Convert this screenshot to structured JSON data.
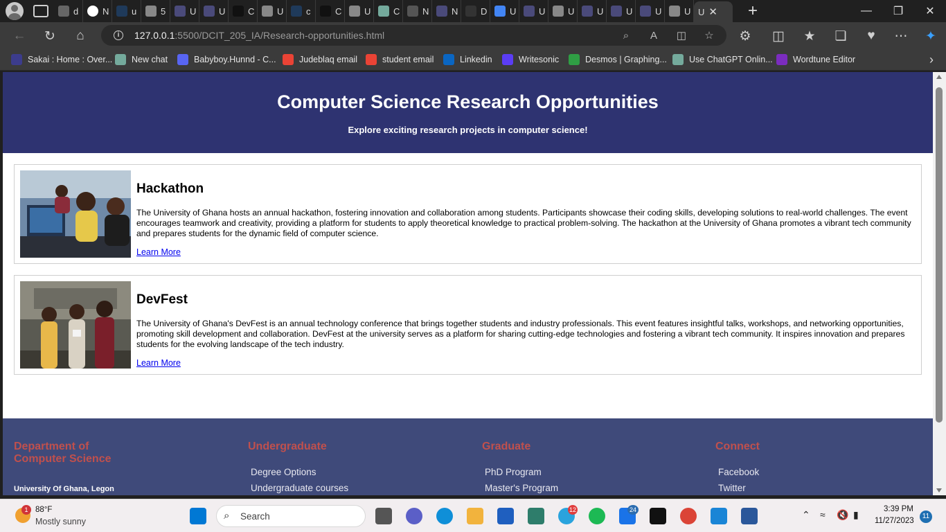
{
  "browser": {
    "active_tab_label": "U",
    "tabs": [
      "d",
      "N",
      "u",
      "5",
      "U",
      "U",
      "C",
      "U",
      "c",
      "C",
      "U",
      "C",
      "N",
      "N",
      "D",
      "U",
      "U",
      "U",
      "U",
      "U",
      "U",
      "U"
    ],
    "url_host": "127.0.0.1",
    "url_rest": ":5500/DCIT_205_IA/Research-opportunities.html"
  },
  "favorites": [
    {
      "label": "Sakai : Home : Over...",
      "color": "#3c3c8c"
    },
    {
      "label": "New chat",
      "color": "#74aa9c"
    },
    {
      "label": "Babyboy.Hunnd - C...",
      "color": "#5865f2"
    },
    {
      "label": "Judeblaq email",
      "color": "#ea4335"
    },
    {
      "label": "student email",
      "color": "#ea4335"
    },
    {
      "label": "Linkedin",
      "color": "#0a66c2"
    },
    {
      "label": "Writesonic",
      "color": "#5b3df5"
    },
    {
      "label": "Desmos | Graphing...",
      "color": "#2f9e44"
    },
    {
      "label": "Use ChatGPT Onlin...",
      "color": "#74aa9c"
    },
    {
      "label": "Wordtune Editor",
      "color": "#7b2cbf"
    }
  ],
  "page": {
    "title": "Computer Science Research Opportunities",
    "subtitle": "Explore exciting research projects in computer science!",
    "cards": [
      {
        "title": "Hackathon",
        "description": "The University of Ghana hosts an annual hackathon, fostering innovation and collaboration among students. Participants showcase their coding skills, developing solutions to real-world challenges. The event encourages teamwork and creativity, providing a platform for students to apply theoretical knowledge to practical problem-solving. The hackathon at the University of Ghana promotes a vibrant tech community and prepares students for the dynamic field of computer science.",
        "link": "Learn More"
      },
      {
        "title": "DevFest",
        "description": "The University of Ghana's DevFest is an annual technology conference that brings together students and industry professionals. This event features insightful talks, workshops, and networking opportunities, promoting skill development and collaboration. DevFest at the university serves as a platform for sharing cutting-edge technologies and fostering a vibrant tech community. It inspires innovation and prepares students for the evolving landscape of the tech industry.",
        "link": "Learn More"
      }
    ],
    "footer": {
      "dept_line1": "Department of",
      "dept_line2": "Computer Science",
      "address": "University Of Ghana, Legon",
      "undergrad_title": "Undergraduate",
      "undergrad_links": [
        "Degree Options",
        "Undergraduate courses"
      ],
      "grad_title": "Graduate",
      "grad_links": [
        "PhD Program",
        "Master's Program"
      ],
      "connect_title": "Connect",
      "connect_links": [
        "Facebook",
        "Twitter"
      ]
    }
  },
  "taskbar": {
    "temperature": "88°F",
    "weather": "Mostly sunny",
    "weather_badge": "1",
    "search_label": "Search",
    "telegram_badge": "12",
    "mail_badge": "24",
    "time": "3:39 PM",
    "date": "11/27/2023",
    "notif_count": "11"
  }
}
